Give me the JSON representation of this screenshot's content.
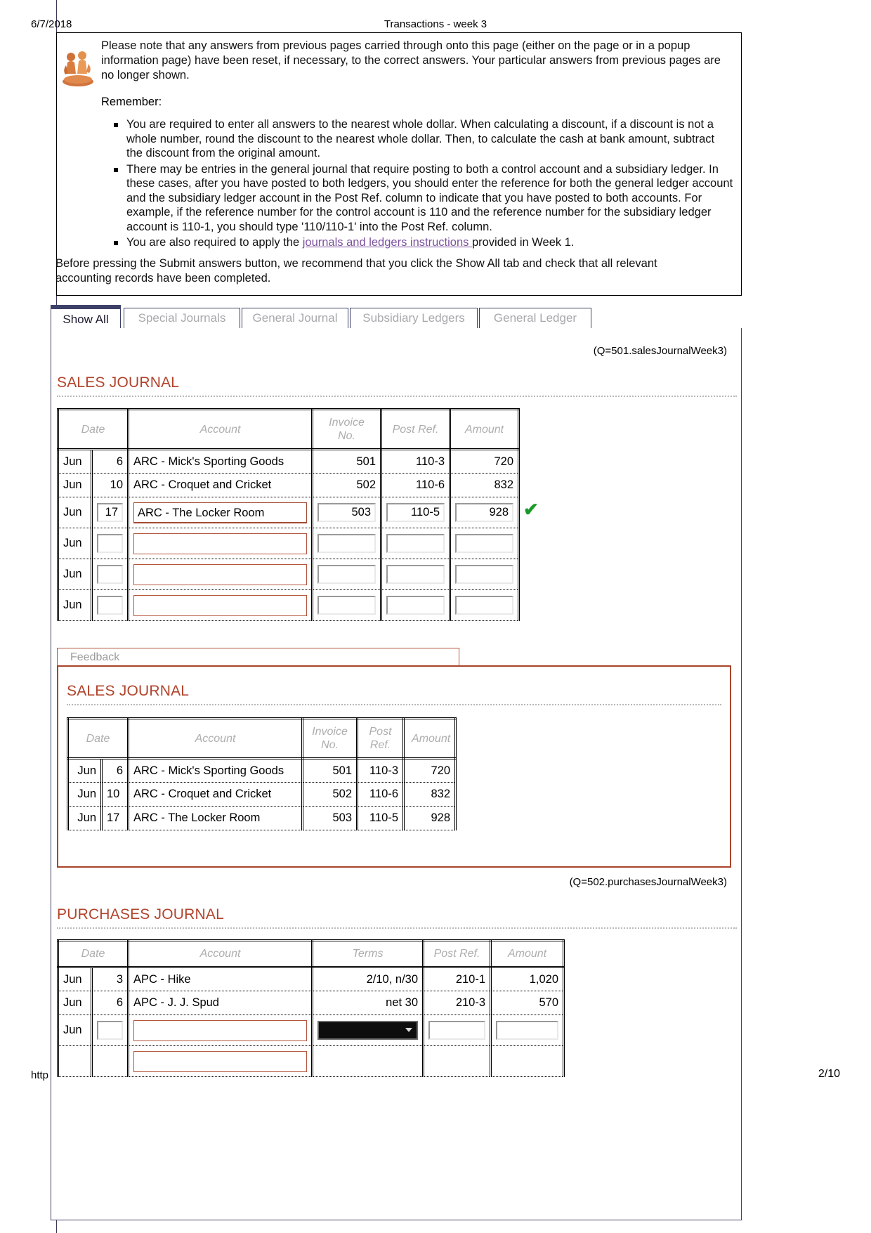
{
  "print_header": {
    "date": "6/7/2018",
    "title": "Transactions - week 3"
  },
  "footer": {
    "url": "http",
    "page": "2/10"
  },
  "note": {
    "icon": "people-discussion-icon",
    "paragraph": "Please note that any answers from previous pages carried through onto this page (either on the page or in a popup information page) have been reset, if necessary, to the correct answers. Your particular answers from previous pages are no longer shown.",
    "remember_label": "Remember:",
    "bullets": [
      "You are required to enter all answers to the nearest whole dollar. When calculating a discount, if a discount is not a whole number, round the discount to the nearest whole dollar. Then, to calculate the cash at bank amount, subtract the discount from the original amount.",
      "There may be entries in the general journal that require posting to both a control account and a subsidiary ledger. In these cases, after you have posted to both ledgers, you should enter the reference for both the general ledger account and the subsidiary ledger account in the Post Ref. column to indicate that you have posted to both accounts. For example, if the reference number for the control account is 110 and the reference number for the subsidiary ledger account is 110-1, you should type '110/110-1' into the Post Ref. column."
    ],
    "bullet3_pre": "You are also required to apply the ",
    "bullet3_link": "journals and ledgers instructions ",
    "bullet3_post": "provided in Week 1.",
    "closing": "Before pressing the Submit answers button, we recommend that you click the Show All tab and check that all relevant accounting records have been completed."
  },
  "tabs": [
    {
      "label": "Show All",
      "active": true
    },
    {
      "label": "Special Journals",
      "active": false
    },
    {
      "label": "General Journal",
      "active": false
    },
    {
      "label": "Subsidiary Ledgers",
      "active": false
    },
    {
      "label": "General Ledger",
      "active": false
    }
  ],
  "sales_journal": {
    "q_label": "(Q=501.salesJournalWeek3)",
    "title": "SALES JOURNAL",
    "headers": [
      "Date",
      "Account",
      "Invoice No.",
      "Post Ref.",
      "Amount"
    ],
    "rows": [
      {
        "month": "Jun",
        "day": "6",
        "account": "ARC - Mick's Sporting Goods",
        "invoice": "501",
        "post_ref": "110-3",
        "amount": "720",
        "editable": false,
        "tick": false
      },
      {
        "month": "Jun",
        "day": "10",
        "account": "ARC - Croquet and Cricket",
        "invoice": "502",
        "post_ref": "110-6",
        "amount": "832",
        "editable": false,
        "tick": false
      },
      {
        "month": "Jun",
        "day": "17",
        "account": "ARC - The Locker Room",
        "invoice": "503",
        "post_ref": "110-5",
        "amount": "928",
        "editable": true,
        "tick": true
      },
      {
        "month": "Jun",
        "day": "",
        "account": "",
        "invoice": "",
        "post_ref": "",
        "amount": "",
        "editable": true,
        "tick": false
      },
      {
        "month": "Jun",
        "day": "",
        "account": "",
        "invoice": "",
        "post_ref": "",
        "amount": "",
        "editable": true,
        "tick": false
      },
      {
        "month": "Jun",
        "day": "",
        "account": "",
        "invoice": "",
        "post_ref": "",
        "amount": "",
        "editable": true,
        "tick": false
      }
    ],
    "tick_symbol": "✔"
  },
  "feedback": {
    "tab_label": "Feedback",
    "title": "SALES JOURNAL",
    "headers": [
      "Date",
      "Account",
      "Invoice No.",
      "Post Ref.",
      "Amount"
    ],
    "rows": [
      {
        "month": "Jun",
        "day": "6",
        "account": "ARC - Mick's Sporting Goods",
        "invoice": "501",
        "post_ref": "110-3",
        "amount": "720"
      },
      {
        "month": "Jun",
        "day": "10",
        "account": "ARC - Croquet and Cricket",
        "invoice": "502",
        "post_ref": "110-6",
        "amount": "832"
      },
      {
        "month": "Jun",
        "day": "17",
        "account": "ARC - The Locker Room",
        "invoice": "503",
        "post_ref": "110-5",
        "amount": "928"
      }
    ]
  },
  "purchases_journal": {
    "q_label": "(Q=502.purchasesJournalWeek3)",
    "title": "PURCHASES JOURNAL",
    "headers": [
      "Date",
      "Account",
      "Terms",
      "Post Ref.",
      "Amount"
    ],
    "rows": [
      {
        "month": "Jun",
        "day": "3",
        "account": "APC - Hike",
        "terms": "2/10, n/30",
        "post_ref": "210-1",
        "amount": "1,020",
        "editable": false,
        "terms_select": false
      },
      {
        "month": "Jun",
        "day": "6",
        "account": "APC - J. J. Spud",
        "terms": "net 30",
        "post_ref": "210-3",
        "amount": "570",
        "editable": false,
        "terms_select": false
      },
      {
        "month": "Jun",
        "day": "",
        "account": "",
        "terms": "",
        "post_ref": "",
        "amount": "",
        "editable": true,
        "terms_select": true
      },
      {
        "month": "",
        "day": "",
        "account": "",
        "terms": "",
        "post_ref": "",
        "amount": "",
        "editable": true,
        "terms_select": false
      }
    ]
  },
  "colors": {
    "heading": "#b1432b",
    "tab_border": "#3d4168",
    "link": "#7b519d",
    "tick": "#1a9a28",
    "feedback_border": "#a9432a"
  }
}
